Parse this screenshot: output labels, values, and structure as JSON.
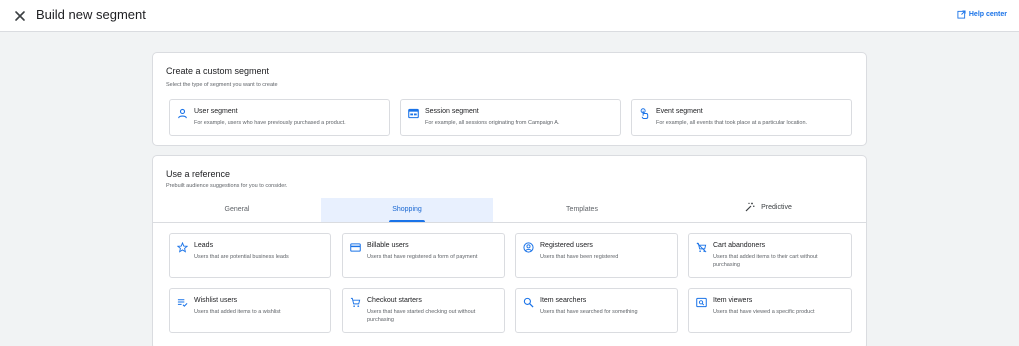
{
  "header": {
    "title": "Build new segment",
    "help_label": "Help center"
  },
  "custom": {
    "title": "Create a custom segment",
    "subtitle": "Select the type of segment you want to create",
    "cards": [
      {
        "icon": "person-icon",
        "title": "User segment",
        "desc": "For example, users who have previously purchased a product."
      },
      {
        "icon": "session-icon",
        "title": "Session segment",
        "desc": "For example, all sessions originating from Campaign A."
      },
      {
        "icon": "touch-icon",
        "title": "Event segment",
        "desc": "For example, all events that took place at a particular location."
      }
    ]
  },
  "reference": {
    "title": "Use a reference",
    "subtitle": "Prebuilt audience suggestions for you to consider.",
    "tabs": [
      "General",
      "Shopping",
      "Templates",
      "Predictive"
    ],
    "active_tab": "Shopping",
    "cards": [
      {
        "icon": "star-icon",
        "title": "Leads",
        "desc": "Users that are potential business leads"
      },
      {
        "icon": "credit-card-icon",
        "title": "Billable users",
        "desc": "Users that have registered a form of payment"
      },
      {
        "icon": "account-circle-icon",
        "title": "Registered users",
        "desc": "Users that have been registered"
      },
      {
        "icon": "cart-off-icon",
        "title": "Cart abandoners",
        "desc": "Users that added items to their cart without purchasing"
      },
      {
        "icon": "playlist-check-icon",
        "title": "Wishlist users",
        "desc": "Users that added items to a wishlist"
      },
      {
        "icon": "cart-icon",
        "title": "Checkout starters",
        "desc": "Users that have started checking out without purchasing"
      },
      {
        "icon": "search-icon",
        "title": "Item searchers",
        "desc": "Users that have searched for something"
      },
      {
        "icon": "item-view-icon",
        "title": "Item viewers",
        "desc": "Users that have viewed a specific product"
      }
    ]
  },
  "colors": {
    "accent": "#1a73e8",
    "tab_active_bg": "#e8f0fe"
  }
}
